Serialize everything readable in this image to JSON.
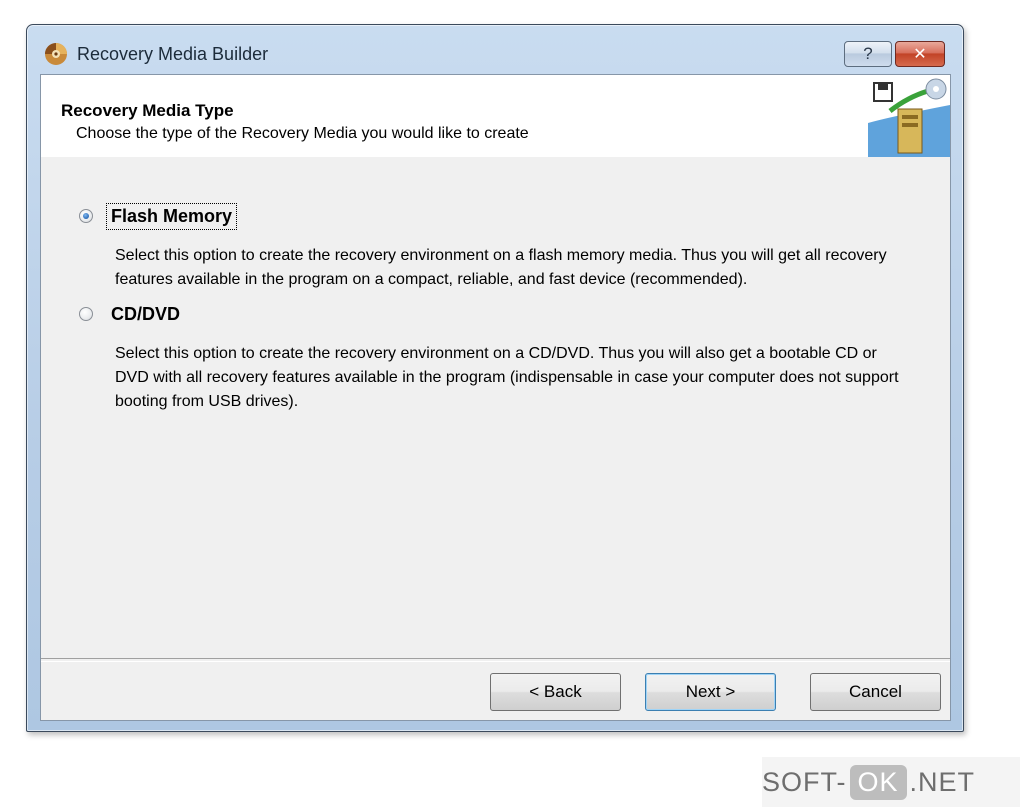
{
  "window": {
    "title": "Recovery Media Builder",
    "help_label": "?",
    "close_label": "✕"
  },
  "header": {
    "title": "Recovery Media Type",
    "subtitle": "Choose the type of the Recovery Media you would like to create"
  },
  "options": [
    {
      "label": "Flash Memory",
      "selected": true,
      "description": "Select this option to create the recovery environment on a flash memory media. Thus you will get all recovery features available in the program on a compact, reliable, and fast device (recommended)."
    },
    {
      "label": "CD/DVD",
      "selected": false,
      "description": "Select this option to create the recovery environment on a CD/DVD. Thus you will also get a bootable CD or DVD with all recovery features available in the program (indispensable in case your computer does not support booting from USB drives)."
    }
  ],
  "buttons": {
    "back": "< Back",
    "next": "Next >",
    "cancel": "Cancel"
  },
  "watermark": {
    "prefix": "SOFT-",
    "highlight": "OK",
    "suffix": ".NET"
  }
}
